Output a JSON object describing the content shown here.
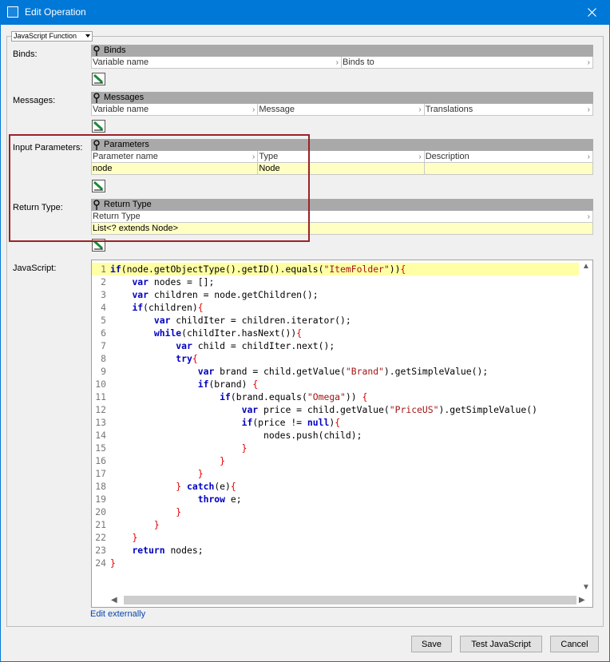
{
  "window": {
    "title": "Edit Operation"
  },
  "mode": {
    "selected": "JavaScript Function"
  },
  "binds": {
    "label": "Binds:",
    "grid_title": "Binds",
    "columns": [
      "Variable name",
      "Binds to"
    ]
  },
  "messages": {
    "label": "Messages:",
    "grid_title": "Messages",
    "columns": [
      "Variable name",
      "Message",
      "Translations"
    ]
  },
  "parameters": {
    "label": "Input Parameters:",
    "grid_title": "Parameters",
    "columns": [
      "Parameter name",
      "Type",
      "Description"
    ],
    "rows": [
      [
        "node",
        "Node",
        ""
      ]
    ]
  },
  "return_type": {
    "label": "Return Type:",
    "grid_title": "Return Type",
    "column": "Return Type",
    "value": "List<? extends Node>"
  },
  "javascript": {
    "label": "JavaScript:",
    "edit_externally": "Edit externally",
    "lines": [
      "if(node.getObjectType().getID().equals(\"ItemFolder\")){",
      "    var nodes = [];",
      "    var children = node.getChildren();",
      "    if(children){",
      "        var childIter = children.iterator();",
      "        while(childIter.hasNext()){",
      "            var child = childIter.next();",
      "            try{",
      "                var brand = child.getValue(\"Brand\").getSimpleValue();",
      "                if(brand) {",
      "                    if(brand.equals(\"Omega\")) {",
      "                        var price = child.getValue(\"PriceUS\").getSimpleValue()",
      "                        if(price != null){",
      "                            nodes.push(child);",
      "                        }",
      "                    }",
      "                }",
      "            } catch(e){",
      "                throw e;",
      "            }",
      "        }",
      "    }",
      "    return nodes;",
      "}"
    ]
  },
  "buttons": {
    "save": "Save",
    "test": "Test JavaScript",
    "cancel": "Cancel"
  }
}
